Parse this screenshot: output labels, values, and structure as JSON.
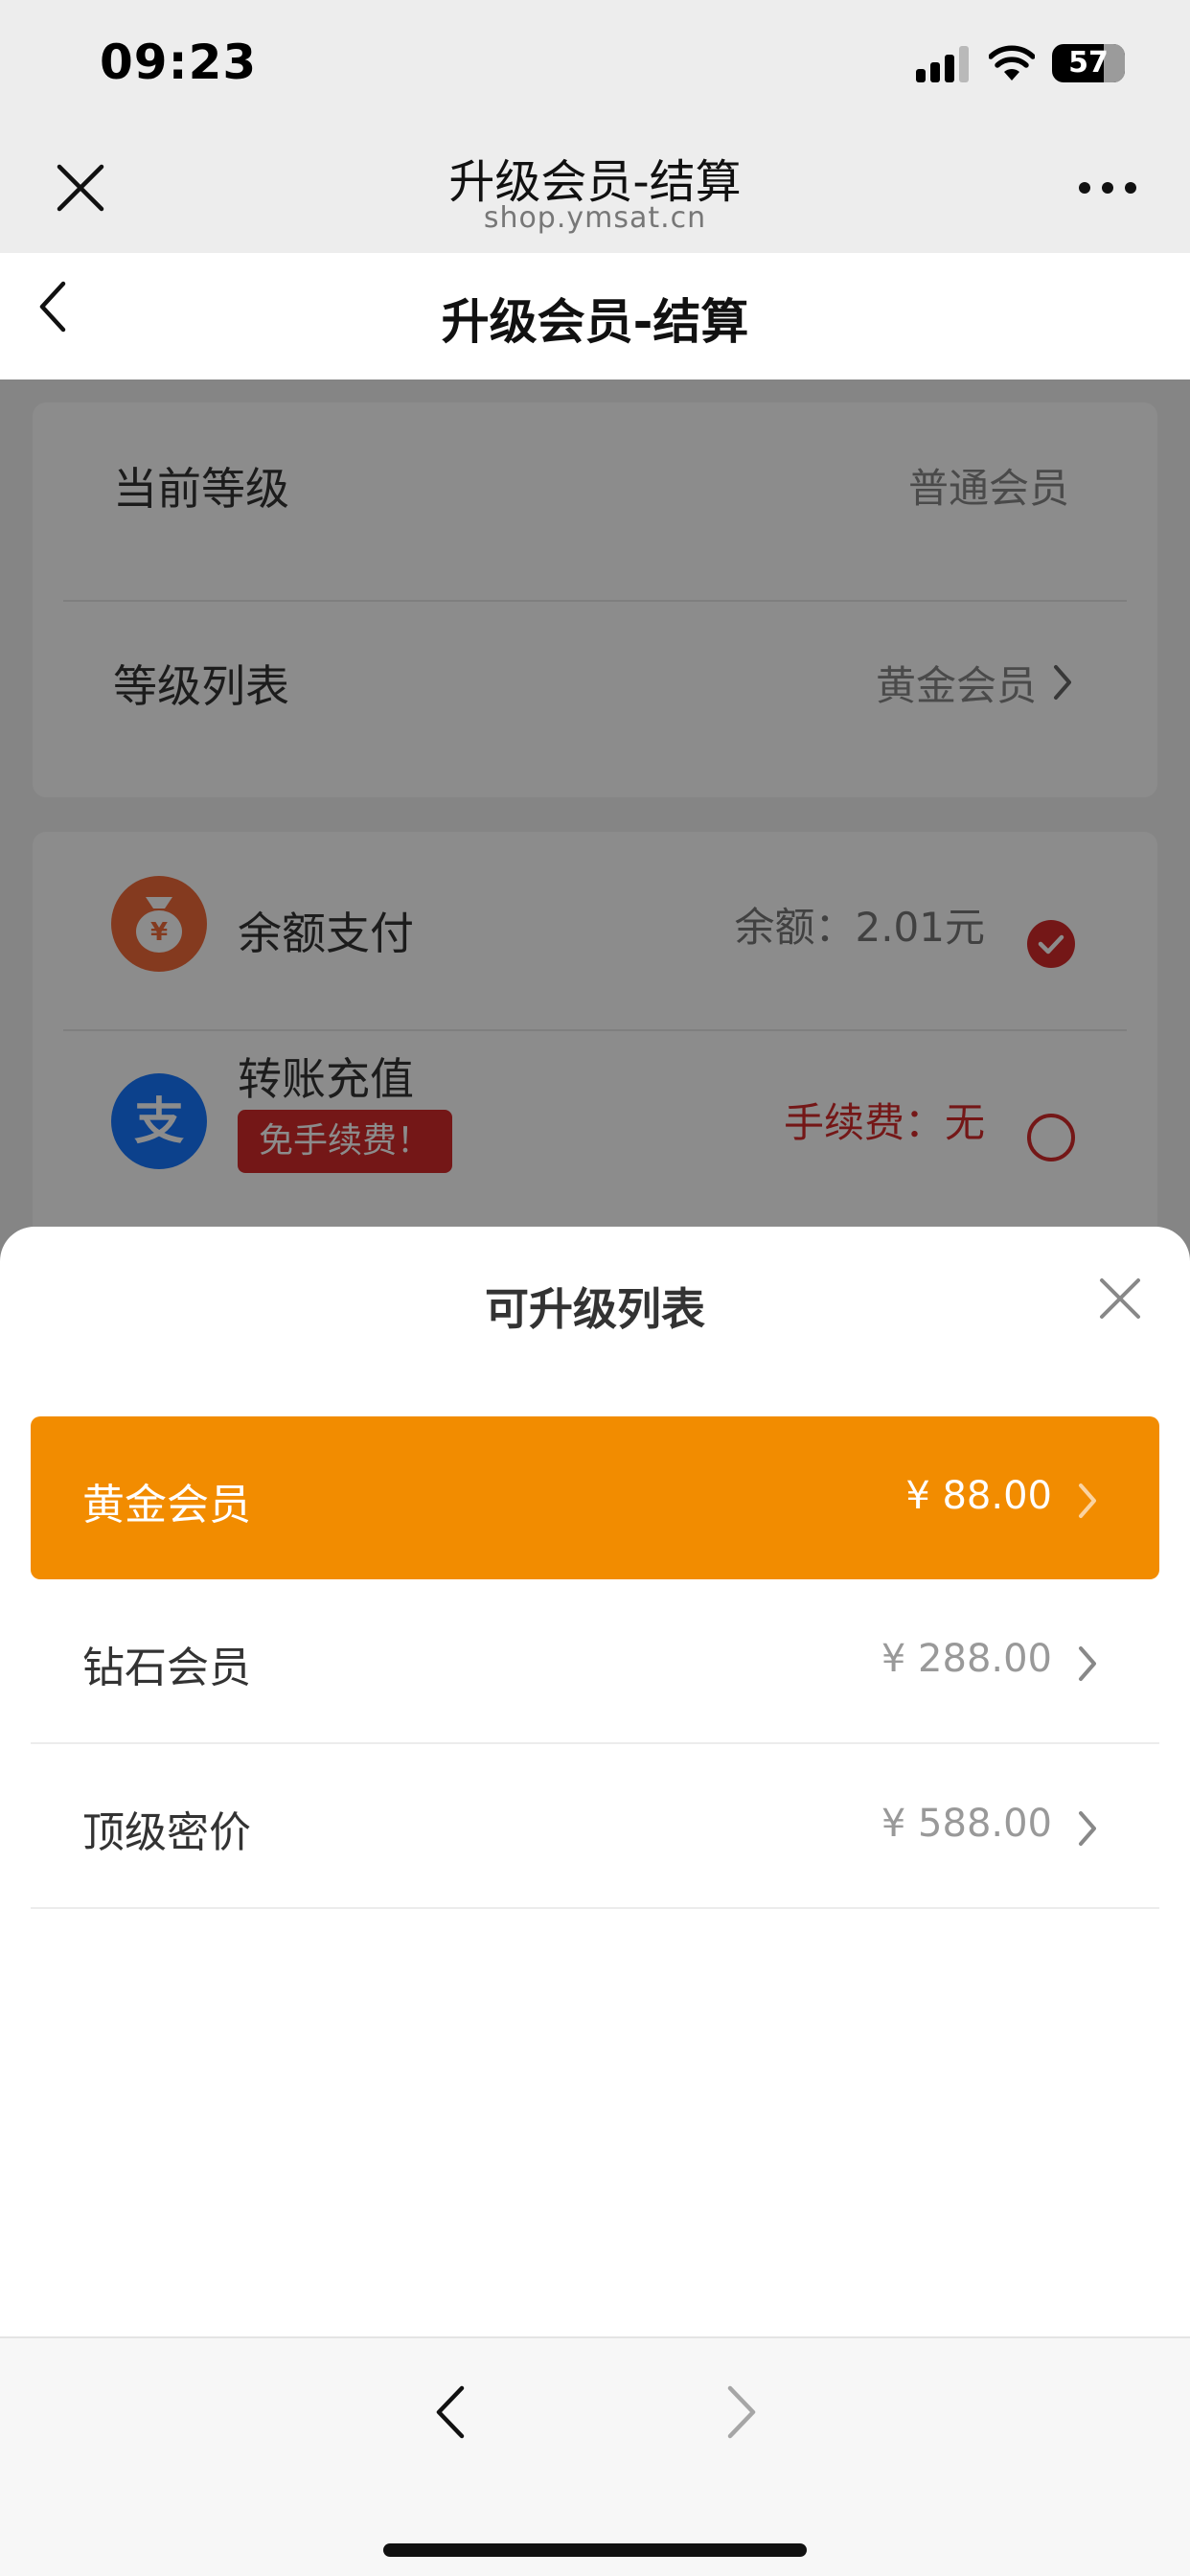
{
  "status_bar": {
    "time": "09:23",
    "battery": "57"
  },
  "browser": {
    "title": "升级会员-结算",
    "url": "shop.ymsat.cn"
  },
  "nav": {
    "title": "升级会员-结算"
  },
  "level_card": {
    "current_label": "当前等级",
    "current_value": "普通会员",
    "list_label": "等级列表",
    "list_value": "黄金会员"
  },
  "payment_card": {
    "balance": {
      "icon": "money-bag-icon",
      "label": "余额支付",
      "amount_text": "余额：2.01元",
      "selected": true
    },
    "transfer": {
      "icon": "alipay-icon",
      "label": "转账充值",
      "badge": "免手续费！",
      "fee_text": "手续费：无",
      "selected": false
    }
  },
  "sheet": {
    "title": "可升级列表",
    "tiers": [
      {
        "name": "黄金会员",
        "price": "¥ 88.00",
        "selected": true
      },
      {
        "name": "钻石会员",
        "price": "¥ 288.00",
        "selected": false
      },
      {
        "name": "顶级密价",
        "price": "¥ 588.00",
        "selected": false
      }
    ]
  },
  "colors": {
    "accent_orange": "#f28c00",
    "accent_red": "#d42b2b",
    "alipay_blue": "#1677ff",
    "balance_orange": "#f06a3a"
  }
}
